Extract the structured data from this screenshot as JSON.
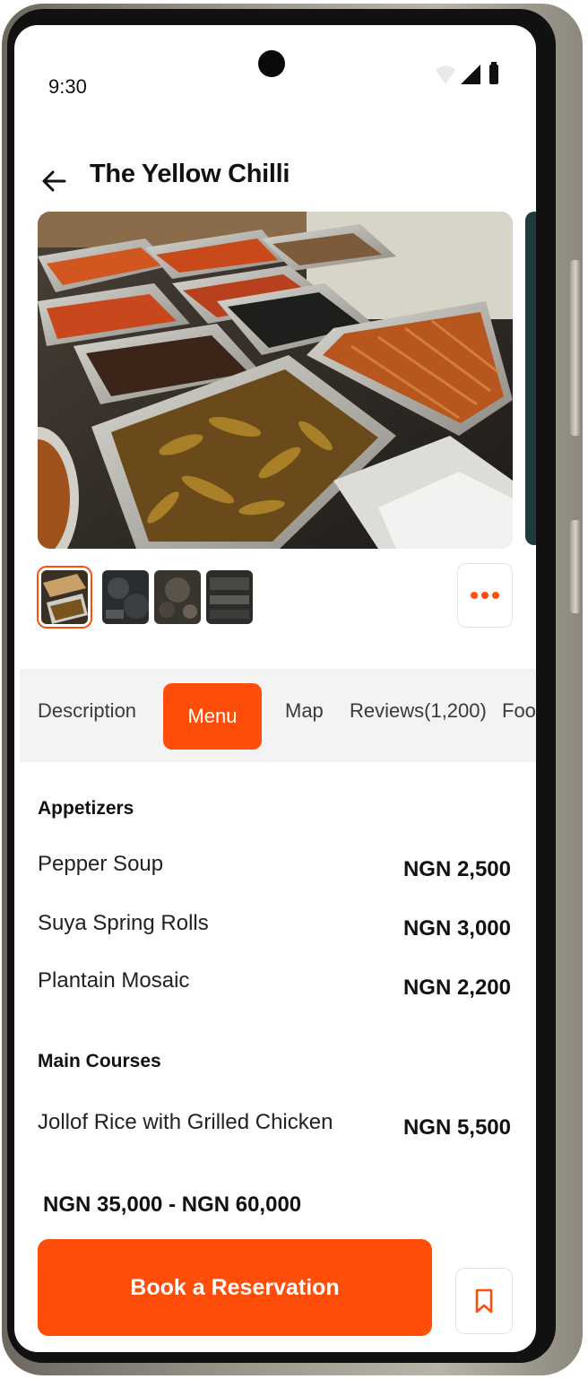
{
  "status_bar": {
    "time": "9:30",
    "icons": [
      "wifi-icon",
      "signal-icon",
      "battery-icon"
    ]
  },
  "header": {
    "back_icon": "arrow-left-icon",
    "title": "The Yellow Chilli"
  },
  "gallery": {
    "main_image": "food-trays-photo",
    "thumbnails": [
      {
        "name": "food-thumb-1",
        "selected": true
      },
      {
        "name": "food-thumb-2",
        "selected": false
      },
      {
        "name": "food-thumb-3",
        "selected": false
      },
      {
        "name": "food-thumb-4",
        "selected": false
      }
    ],
    "more_icon": "more-horizontal-icon"
  },
  "tabs": [
    {
      "label": "Description",
      "active": false
    },
    {
      "label": "Menu",
      "active": true
    },
    {
      "label": "Map",
      "active": false
    },
    {
      "label": "Reviews(1,200)",
      "active": false
    },
    {
      "label": "Foo",
      "active": false
    }
  ],
  "menu": {
    "sections": [
      {
        "title": "Appetizers",
        "items": [
          {
            "name": "Pepper Soup",
            "price": "NGN 2,500"
          },
          {
            "name": "Suya Spring Rolls",
            "price": "NGN 3,000"
          },
          {
            "name": "Plantain Mosaic",
            "price": "NGN 2,200"
          }
        ]
      },
      {
        "title": "Main Courses",
        "items": [
          {
            "name": "Jollof Rice with Grilled Chicken",
            "price": "NGN 5,500"
          }
        ]
      }
    ]
  },
  "footer": {
    "price_range": "NGN 35,000 - NGN 60,000",
    "book_label": "Book a Reservation",
    "bookmark_icon": "bookmark-icon"
  },
  "colors": {
    "accent": "#ff4d0a",
    "tab_bar_bg": "#f3f3f3",
    "text_dark": "#111111"
  }
}
